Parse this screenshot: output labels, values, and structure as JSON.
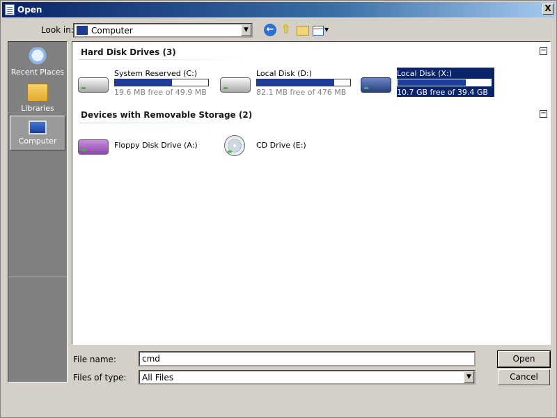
{
  "window": {
    "title": "Open",
    "close_label": "X"
  },
  "toolbar": {
    "lookin_label": "Look in:",
    "lookin_value": "Computer",
    "back_icon": "back-arrow-icon",
    "up_icon": "up-folder-icon",
    "newfolder_icon": "new-folder-icon",
    "views_icon": "views-menu-icon"
  },
  "places": [
    {
      "label": "Recent Places",
      "icon": "recent-places-icon",
      "selected": false
    },
    {
      "label": "Libraries",
      "icon": "libraries-icon",
      "selected": false
    },
    {
      "label": "Computer",
      "icon": "computer-icon",
      "selected": true
    }
  ],
  "groups": {
    "hdd": {
      "title": "Hard Disk Drives (3)",
      "drives": [
        {
          "name": "System Reserved (C:)",
          "free": "19.6 MB free of 49.9 MB",
          "used_fraction": 0.61
        },
        {
          "name": "Local Disk (D:)",
          "free": "82.1 MB free of 476 MB",
          "used_fraction": 0.83
        },
        {
          "name": "Local Disk (X:)",
          "free": "10.7 GB free of 39.4 GB",
          "used_fraction": 0.73,
          "selected": true
        }
      ]
    },
    "removable": {
      "title": "Devices with Removable Storage (2)",
      "drives": [
        {
          "name": "Floppy Disk Drive (A:)",
          "icon": "floppy-drive-icon"
        },
        {
          "name": "CD Drive (E:)",
          "icon": "cd-drive-icon"
        }
      ]
    }
  },
  "footer": {
    "filename_label": "File name:",
    "filename_value": "cmd",
    "filetype_label": "Files of type:",
    "filetype_value": "All Files",
    "open_label": "Open",
    "cancel_label": "Cancel"
  },
  "colors": {
    "selection": "#0a246a",
    "bar_fill": "#1e3d9a",
    "face": "#d4d0c8"
  }
}
